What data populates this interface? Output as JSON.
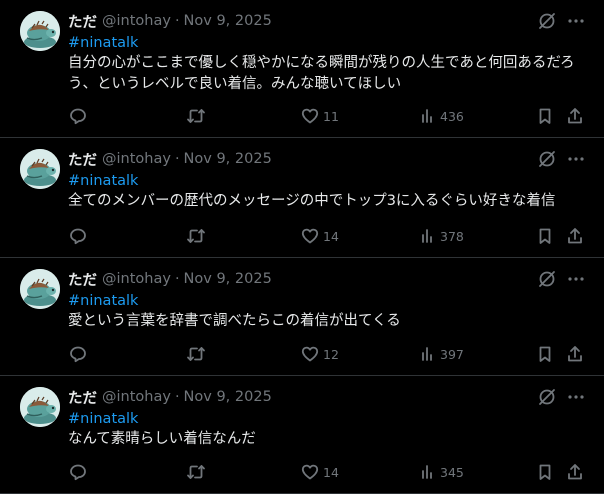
{
  "tweets": [
    {
      "author_name": "ただ",
      "handle": "@intohay",
      "separator": "·",
      "date": "Nov 9, 2025",
      "hashtag": "#ninatalk",
      "text": "自分の心がここまで優しく穏やかになる瞬間が残りの人生であと何回あるだろう、というレベルで良い着信。みんな聴いてほしい",
      "likes": "11",
      "views": "436"
    },
    {
      "author_name": "ただ",
      "handle": "@intohay",
      "separator": "·",
      "date": "Nov 9, 2025",
      "hashtag": "#ninatalk",
      "text": "全てのメンバーの歴代のメッセージの中でトップ3に入るぐらい好きな着信",
      "likes": "14",
      "views": "378"
    },
    {
      "author_name": "ただ",
      "handle": "@intohay",
      "separator": "·",
      "date": "Nov 9, 2025",
      "hashtag": "#ninatalk",
      "text": "愛という言葉を辞書で調べたらこの着信が出てくる",
      "likes": "12",
      "views": "397"
    },
    {
      "author_name": "ただ",
      "handle": "@intohay",
      "separator": "·",
      "date": "Nov 9, 2025",
      "hashtag": "#ninatalk",
      "text": "なんて素晴らしい着信なんだ",
      "likes": "14",
      "views": "345"
    }
  ],
  "icons": {
    "reply": "reply-icon",
    "retweet": "retweet-icon",
    "like": "heart-icon",
    "views": "views-chart-icon",
    "bookmark": "bookmark-icon",
    "share": "share-icon",
    "grok": "grok-icon",
    "more": "more-icon"
  },
  "colors": {
    "background": "#000000",
    "text": "#e7e9ea",
    "secondary": "#71767b",
    "link": "#1d9bf0",
    "divider": "#2f3336"
  }
}
